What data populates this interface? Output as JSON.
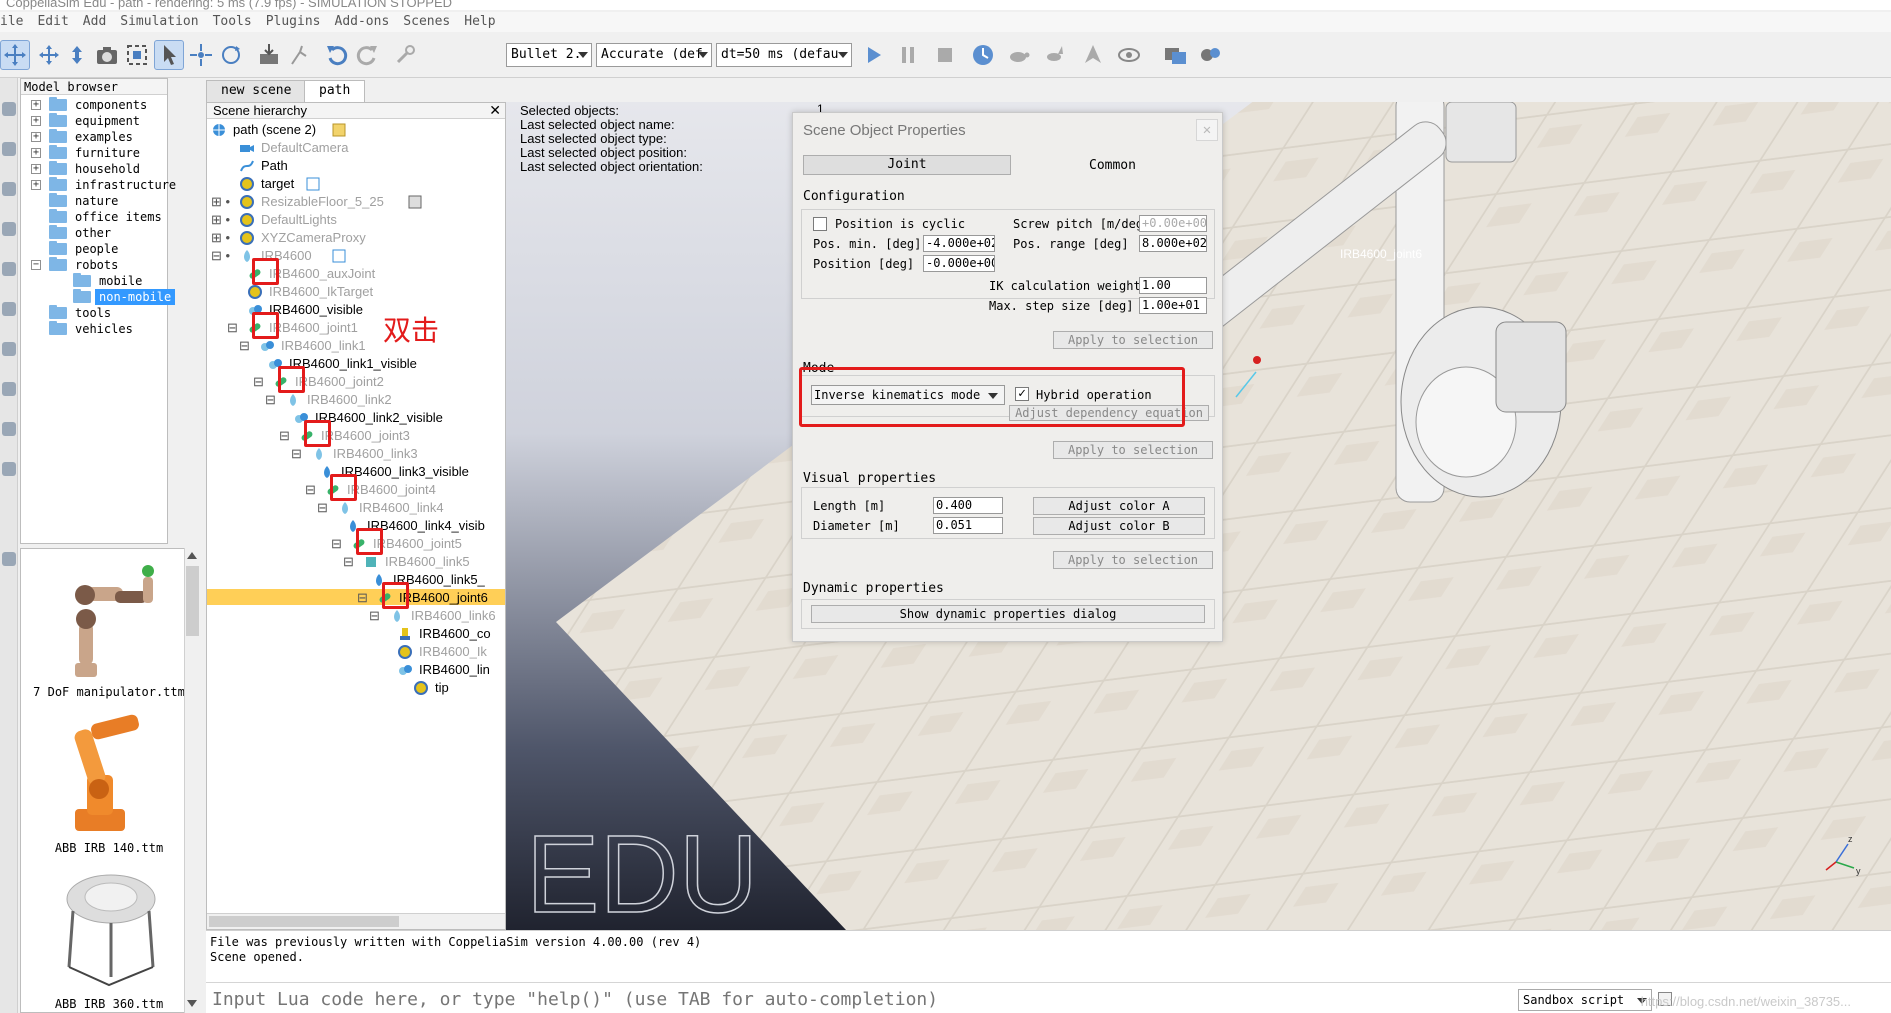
{
  "window": {
    "title": "CoppeliaSim Edu - path - rendering: 5 ms (7.9 fps) - SIMULATION STOPPED"
  },
  "menu": [
    "ile",
    "Edit",
    "Add",
    "Simulation",
    "Tools",
    "Plugins",
    "Add-ons",
    "Scenes",
    "Help"
  ],
  "toolbar": {
    "engine": "Bullet 2.",
    "accuracy": "Accurate (def",
    "timestep": "dt=50 ms (defau"
  },
  "model_browser": {
    "title": "Model browser",
    "items": [
      {
        "label": "components",
        "expander": "+"
      },
      {
        "label": "equipment",
        "expander": "+"
      },
      {
        "label": "examples",
        "expander": "+"
      },
      {
        "label": "furniture",
        "expander": "+"
      },
      {
        "label": "household",
        "expander": "+"
      },
      {
        "label": "infrastructure",
        "expander": "+"
      },
      {
        "label": "nature",
        "expander": ""
      },
      {
        "label": "office items",
        "expander": ""
      },
      {
        "label": "other",
        "expander": ""
      },
      {
        "label": "people",
        "expander": ""
      },
      {
        "label": "robots",
        "expander": "−"
      },
      {
        "label": "mobile",
        "expander": ""
      },
      {
        "label": "non-mobile",
        "expander": ""
      },
      {
        "label": "tools",
        "expander": ""
      },
      {
        "label": "vehicles",
        "expander": ""
      }
    ],
    "thumbnails": [
      "7 DoF manipulator.ttm",
      "ABB IRB 140.ttm",
      "ABB IRB 360.ttm"
    ]
  },
  "tabs": [
    "new scene",
    "path"
  ],
  "hierarchy": {
    "title": "Scene hierarchy",
    "annotation": "双击",
    "rows": [
      "path (scene 2)",
      "DefaultCamera",
      "Path",
      "target",
      "ResizableFloor_5_25",
      "DefaultLights",
      "XYZCameraProxy",
      "IRB4600",
      "IRB4600_auxJoint",
      "IRB4600_IkTarget",
      "IRB4600_visible",
      "IRB4600_joint1",
      "IRB4600_link1",
      "IRB4600_link1_visible",
      "IRB4600_joint2",
      "IRB4600_link2",
      "IRB4600_link2_visible",
      "IRB4600_joint3",
      "IRB4600_link3",
      "IRB4600_link3_visible",
      "IRB4600_joint4",
      "IRB4600_link4",
      "IRB4600_link4_visib",
      "IRB4600_joint5",
      "IRB4600_link5",
      "IRB4600_link5_",
      "IRB4600_joint6",
      "IRB4600_link6",
      "IRB4600_co",
      "IRB4600_Ik",
      "IRB4600_lin",
      "tip"
    ]
  },
  "info": {
    "lines": [
      "Selected objects:",
      "Last selected object name:",
      "Last selected object type:",
      "Last selected object position:",
      "Last selected object orientation:"
    ],
    "selected_count": "1"
  },
  "viewport": {
    "edu_logo": "EDU",
    "joint_label": "IRB4600_joint6"
  },
  "dialog": {
    "title": "Scene Object Properties",
    "tab_joint": "Joint",
    "tab_common": "Common",
    "configuration": "Configuration",
    "position_cyclic": "Position is cyclic",
    "screw_pitch_label": "Screw pitch [m/deg",
    "screw_pitch": "+0.00e+00",
    "pos_min_label": "Pos. min. [deg]",
    "pos_min": "-4.000e+02",
    "pos_range_label": "Pos. range [deg]",
    "pos_range": "8.000e+02",
    "position_label": "Position [deg]",
    "position": "-0.000e+00",
    "ik_weight_label": "IK calculation weight",
    "ik_weight": "1.00",
    "max_step_label": "Max. step size [deg]",
    "max_step": "1.00e+01",
    "apply": "Apply to selection",
    "mode": "Mode",
    "mode_value": "Inverse kinematics mode",
    "hybrid": "Hybrid operation",
    "adjust_dep": "Adjust dependency equation",
    "visual": "Visual properties",
    "length_label": "Length [m]",
    "length": "0.400",
    "diameter_label": "Diameter [m]",
    "diameter": "0.051",
    "adjust_a": "Adjust color A",
    "adjust_b": "Adjust color B",
    "dynamic": "Dynamic properties",
    "show_dynamic": "Show dynamic properties dialog"
  },
  "console": {
    "lines": [
      "File was previously written with CoppeliaSim version 4.00.00 (rev 4)",
      "Scene opened."
    ],
    "lua_placeholder": "Input Lua code here, or type \"help()\" (use TAB for auto-completion)",
    "sandbox": "Sandbox script",
    "watermark": "https://blog.csdn.net/weixin_38735..."
  },
  "colors": {
    "highlight": "#ffcf57",
    "selection": "#3399ff",
    "annotation": "#e31b1b"
  }
}
